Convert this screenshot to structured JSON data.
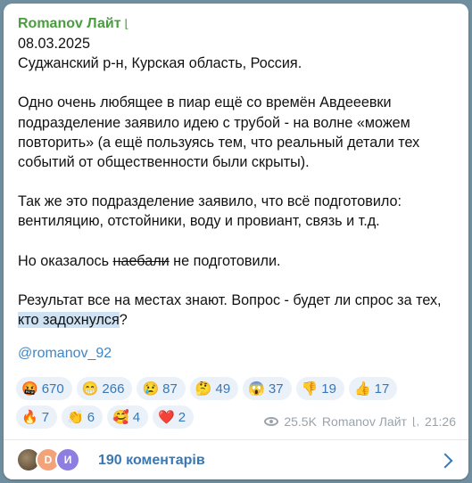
{
  "post": {
    "channel": "Romanov Лайт",
    "channel_badge_icon": "bookmark-icon",
    "date": "08.03.2025",
    "location": "Суджанский р-н, Курская область, Россия.",
    "para1": "Одно очень любящее в пиар ещё со времён Авдееевки подразделение заявило идею с трубой - на волне «можем повторить» (а ещё пользуясь тем, что реальный детали тех событий от общественности были скрыты).",
    "para2": "Так же это подразделение заявило, что всё подготовило: вентиляцию, отстойники, воду и провиант, связь и т.д.",
    "para3_before": "Но оказалось ",
    "para3_strike": "наебали",
    "para3_after": " не подготовили.",
    "para4_main": "Результат все на местах знают. Вопрос - будет ли спрос за тех, ",
    "para4_highlight": "кто  задохнулся",
    "para4_end": "?",
    "mention": "@romanov_92"
  },
  "reactions_row1": [
    {
      "emoji": "🤬",
      "count": "670"
    },
    {
      "emoji": "😁",
      "count": "266"
    },
    {
      "emoji": "😢",
      "count": "87"
    },
    {
      "emoji": "🤔",
      "count": "49"
    },
    {
      "emoji": "😱",
      "count": "37"
    },
    {
      "emoji": "👎",
      "count": "19"
    },
    {
      "emoji": "👍",
      "count": "17"
    }
  ],
  "reactions_row2": [
    {
      "emoji": "🔥",
      "count": "7"
    },
    {
      "emoji": "👏",
      "count": "6"
    },
    {
      "emoji": "🥰",
      "count": "4"
    },
    {
      "emoji": "❤️",
      "count": "2"
    }
  ],
  "meta": {
    "views": "25.5K",
    "author": "Romanov Лайт",
    "time": "21:26"
  },
  "comments": {
    "avatar2_letter": "D",
    "avatar3_letter": "И",
    "label": "190 коментарів"
  },
  "colors": {
    "accent": "#3a78b3",
    "channel": "#4a9d3f",
    "chip_bg": "#eaf1f8"
  }
}
